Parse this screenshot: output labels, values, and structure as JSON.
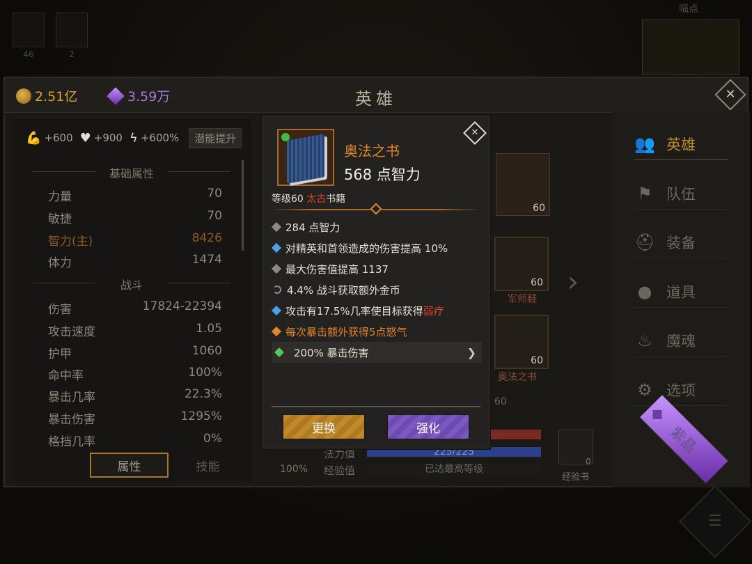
{
  "background": {
    "slot_counts": [
      "46",
      "2"
    ],
    "map_label": "幅点"
  },
  "window": {
    "title": "英雄",
    "gold": "2.51亿",
    "gems": "3.59万"
  },
  "left_panel": {
    "boosts": [
      "+600",
      "+900",
      "+600%"
    ],
    "potential_button": "潜能提升",
    "section_basic": "基础属性",
    "basic_stats": [
      {
        "label": "力量",
        "value": "70"
      },
      {
        "label": "敏捷",
        "value": "70"
      },
      {
        "label": "智力(主)",
        "value": "8426"
      },
      {
        "label": "体力",
        "value": "1474"
      }
    ],
    "section_combat": "战斗",
    "combat_stats": [
      {
        "label": "伤害",
        "value": "17824-22394"
      },
      {
        "label": "攻击速度",
        "value": "1.05"
      },
      {
        "label": "护甲",
        "value": "1060"
      },
      {
        "label": "命中率",
        "value": "100%"
      },
      {
        "label": "暴击几率",
        "value": "22.3%"
      },
      {
        "label": "暴击伤害",
        "value": "1295%"
      },
      {
        "label": "格挡几率",
        "value": "0%"
      }
    ],
    "tabs": [
      "属性",
      "技能"
    ]
  },
  "middle": {
    "hero_card_level": "60",
    "boots_level": "60",
    "boots_label": "军师鞋",
    "book_level": "60",
    "book_label": "奥法之书",
    "partial_level": "60",
    "mana_label": "法力值",
    "mana_value": "225/225",
    "xp_label": "经验值",
    "xp_value": "已达最高等级",
    "percent_under": "100%",
    "xp_book_label": "经验书",
    "xp_book_count": "0",
    "ghost_id": "14ba0850b-e674-4c1-a916"
  },
  "nav": {
    "items": [
      "英雄",
      "队伍",
      "装备",
      "道具",
      "魔魂",
      "选项",
      "紫晶"
    ]
  },
  "popup": {
    "item_name": "奥法之书",
    "main_stat": "568 点智力",
    "level_prefix": "等级60 ",
    "rarity": "太古",
    "type": "书籍",
    "attributes": [
      {
        "text": "284 点智力"
      },
      {
        "text": "对精英和首领造成的伤害提高 10%"
      },
      {
        "text": "最大伤害值提高 1137"
      },
      {
        "text": "4.4% 战斗获取额外金币"
      },
      {
        "text": "攻击有17.5%几率使目标获得",
        "highlight": "弱疗"
      },
      {
        "text": "每次暴击额外获得5点怒气"
      },
      {
        "text": "200% 暴击伤害"
      }
    ],
    "swap_button": "更换",
    "upgrade_button": "强化"
  },
  "colors": {
    "accent_orange": "#e0842a",
    "rarity_red": "#e0442a",
    "gold": "#d9a439",
    "purple": "#a37ad9"
  }
}
